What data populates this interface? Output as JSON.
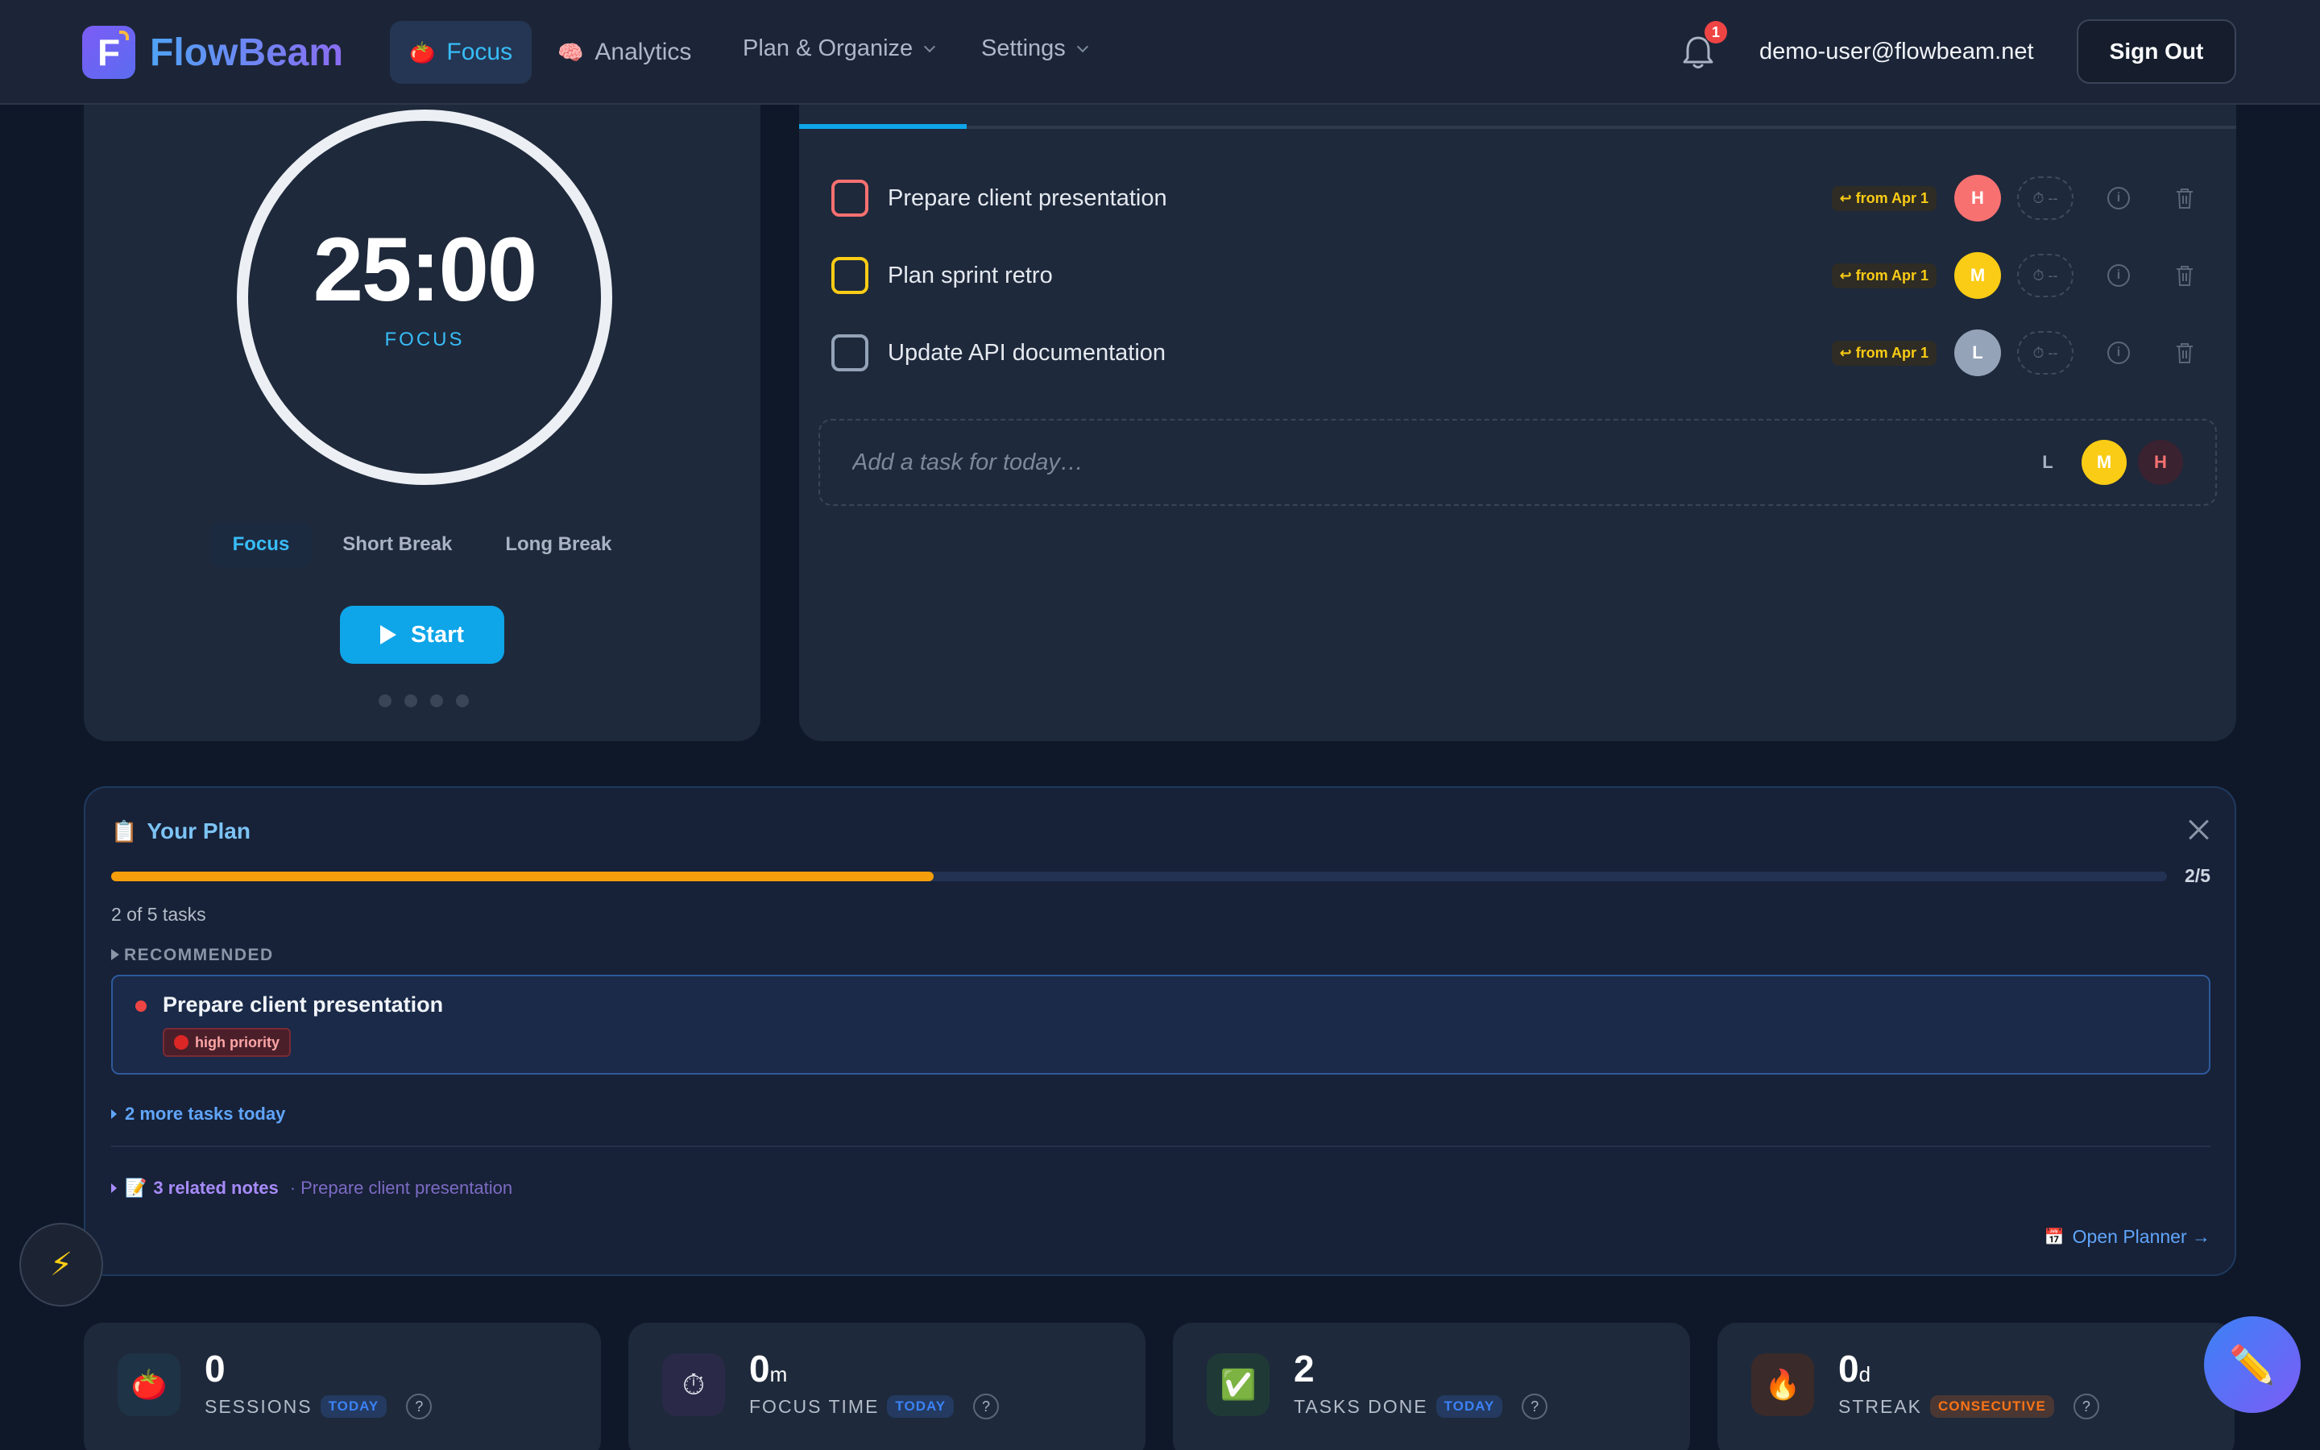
{
  "header": {
    "brand": "FlowBeam",
    "brand_initial": "F",
    "nav": {
      "focus": "Focus",
      "analytics": "Analytics",
      "plan": "Plan & Organize",
      "settings": "Settings"
    },
    "notification_count": "1",
    "user_email": "demo-user@flowbeam.net",
    "sign_out": "Sign Out"
  },
  "timer": {
    "time": "25:00",
    "label": "FOCUS",
    "modes": [
      "Focus",
      "Short Break",
      "Long Break"
    ],
    "active_mode": "Focus",
    "start": "Start",
    "session_dots": 4
  },
  "tasks": {
    "items": [
      {
        "title": "Prepare client presentation",
        "from": "↩ from Apr 1",
        "priority": "H",
        "estimate": "⏱ --",
        "color": "#f87171"
      },
      {
        "title": "Plan sprint retro",
        "from": "↩ from Apr 1",
        "priority": "M",
        "estimate": "⏱ --",
        "color": "#facc15"
      },
      {
        "title": "Update API documentation",
        "from": "↩ from Apr 1",
        "priority": "L",
        "estimate": "⏱ --",
        "color": "#94a3b8"
      }
    ],
    "add_placeholder": "Add a task for today…",
    "priority_options": [
      "L",
      "M",
      "H"
    ],
    "selected_priority": "M"
  },
  "plan": {
    "title": "Your Plan",
    "progress": 0.4,
    "progress_label": "2/5",
    "count_text": "2 of 5 tasks",
    "recommended_label": "RECOMMENDED",
    "recommended_task": "Prepare client presentation",
    "recommended_badge": "high priority",
    "more_tasks": "2 more tasks today",
    "notes_count": "3 related notes",
    "notes_sub": "· Prepare client presentation",
    "open_planner": "Open Planner →"
  },
  "stats": [
    {
      "icon": "🍅",
      "value": "0",
      "unit": "",
      "label": "SESSIONS",
      "badge": "TODAY",
      "badge_color": "#3b82f6"
    },
    {
      "icon": "⏱",
      "value": "0",
      "unit": "m",
      "label": "FOCUS TIME",
      "badge": "TODAY",
      "badge_color": "#3b82f6"
    },
    {
      "icon": "✅",
      "value": "2",
      "unit": "",
      "label": "TASKS DONE",
      "badge": "TODAY",
      "badge_color": "#3b82f6"
    },
    {
      "icon": "🔥",
      "value": "0",
      "unit": "d",
      "label": "STREAK",
      "badge": "CONSECUTIVE",
      "badge_color": "#f97316"
    }
  ],
  "help_glyph": "?",
  "colors": {
    "accent": "#0ea5e9",
    "background": "#0f1829",
    "card": "#1e293b",
    "progress": "#f59e0b"
  }
}
